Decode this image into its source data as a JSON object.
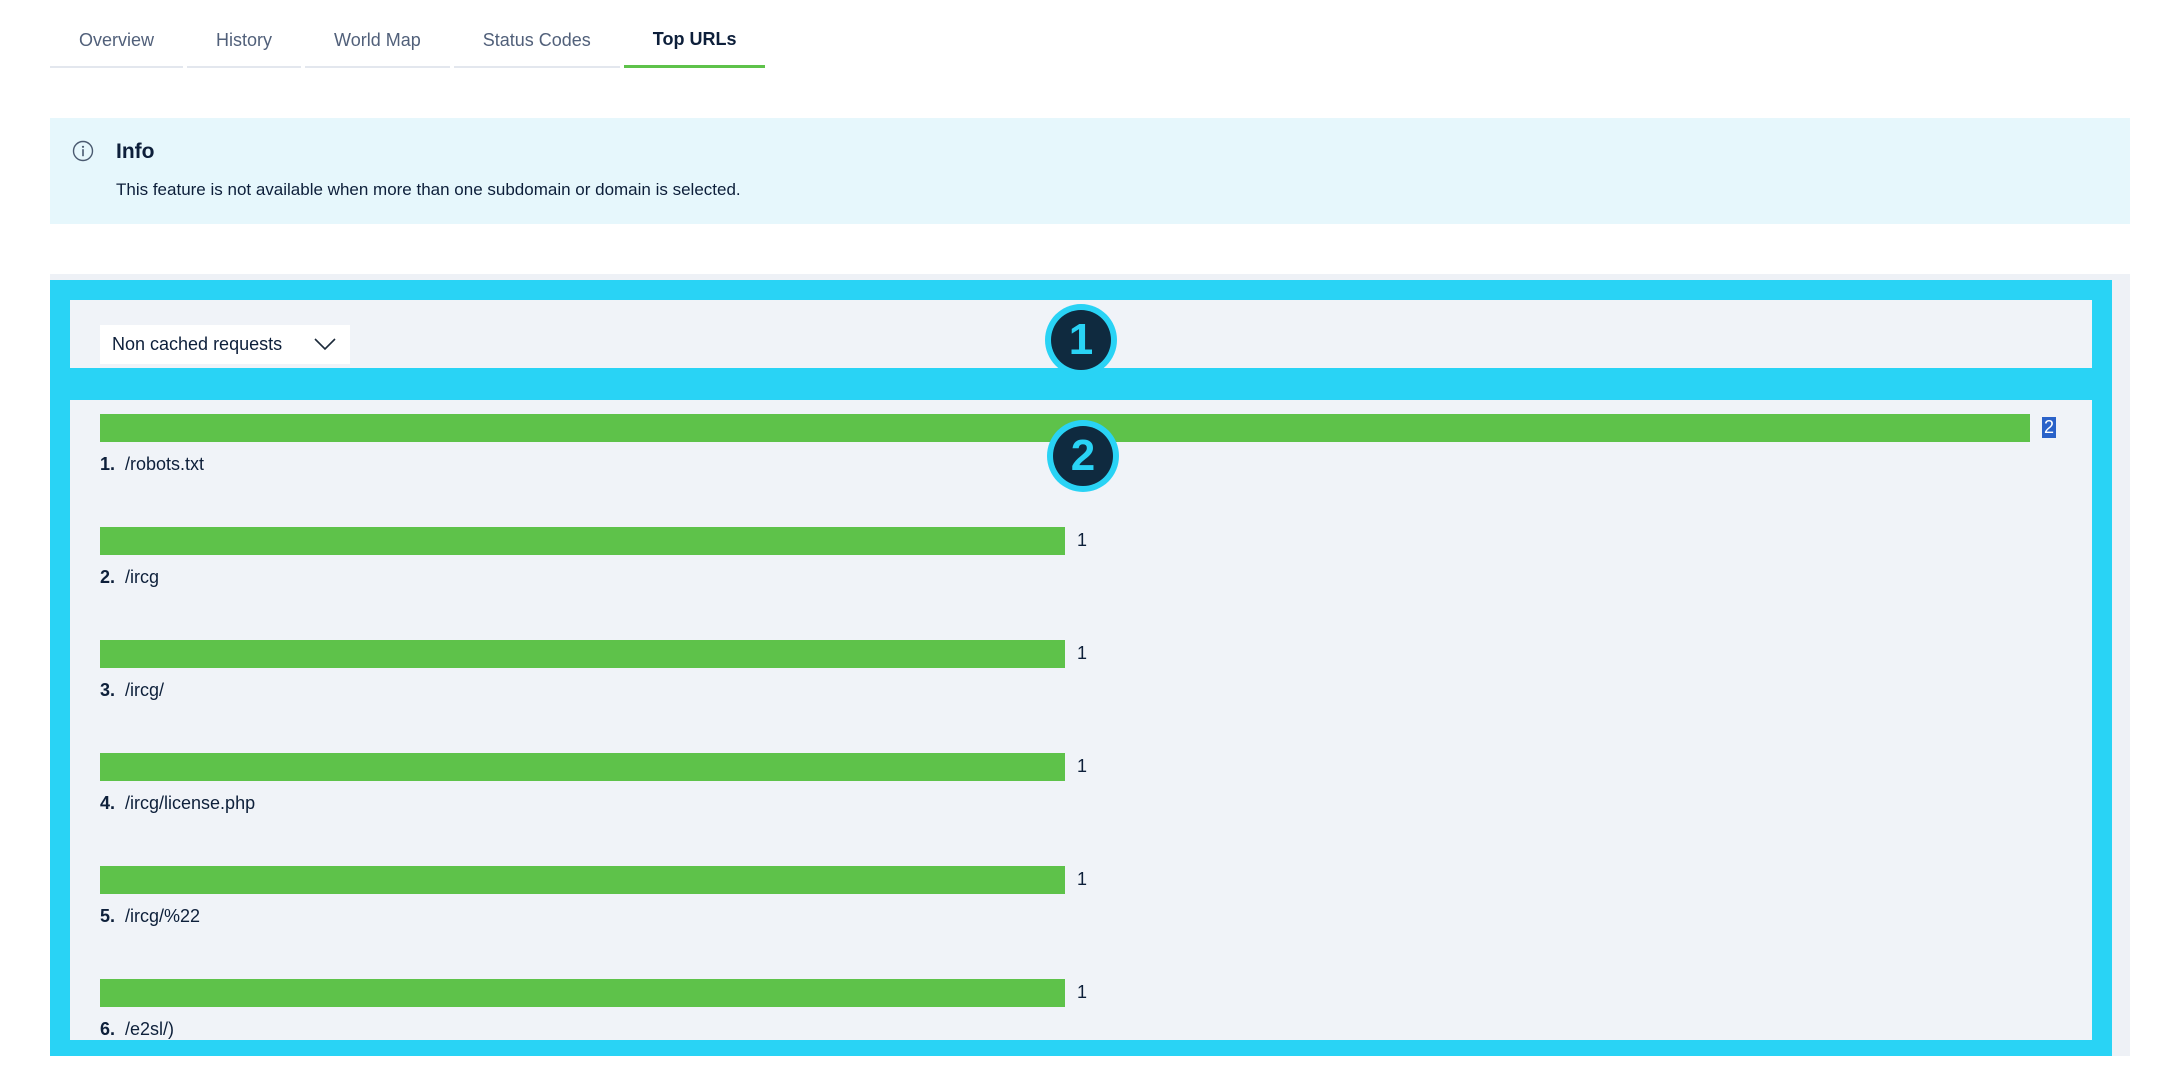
{
  "tabs": [
    {
      "label": "Overview",
      "active": false
    },
    {
      "label": "History",
      "active": false
    },
    {
      "label": "World Map",
      "active": false
    },
    {
      "label": "Status Codes",
      "active": false
    },
    {
      "label": "Top URLs",
      "active": true
    }
  ],
  "info": {
    "icon": "info-circle-icon",
    "title": "Info",
    "text": "This feature is not available when more than one subdomain or domain is selected."
  },
  "filter": {
    "selected": "Non cached requests",
    "icon": "chevron-down-icon"
  },
  "markers": [
    "1",
    "2"
  ],
  "top_urls": {
    "max": 2,
    "items": [
      {
        "rank": "1.",
        "url": "/robots.txt",
        "count": 2,
        "count_label": "2"
      },
      {
        "rank": "2.",
        "url": "/ircg",
        "count": 1,
        "count_label": "1"
      },
      {
        "rank": "3.",
        "url": "/ircg/",
        "count": 1,
        "count_label": "1"
      },
      {
        "rank": "4.",
        "url": "/ircg/license.php",
        "count": 1,
        "count_label": "1"
      },
      {
        "rank": "5.",
        "url": "/ircg/%22",
        "count": 1,
        "count_label": "1"
      },
      {
        "rank": "6.",
        "url": "/e2sl/)",
        "count": 1,
        "count_label": "1"
      }
    ]
  },
  "colors": {
    "accent": "#5ec24a",
    "highlight": "#29d3f5",
    "info_bg": "#e6f7fc"
  }
}
